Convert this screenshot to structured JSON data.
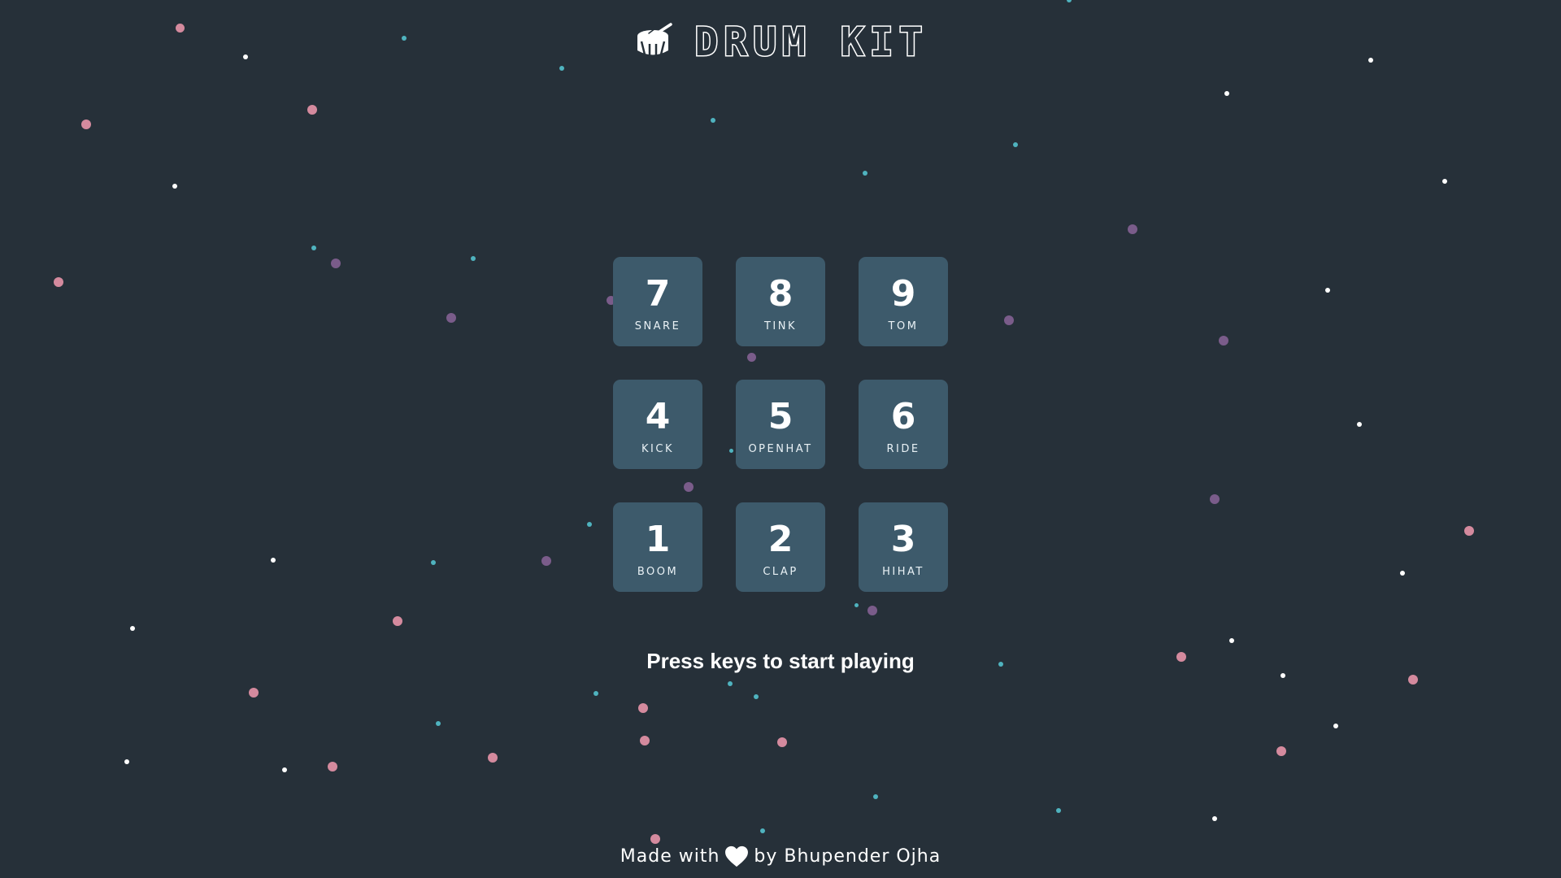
{
  "app": {
    "title": "DRUM KIT",
    "icon": "drum-icon"
  },
  "pads": [
    {
      "key": "7",
      "sound": "SNARE"
    },
    {
      "key": "8",
      "sound": "TINK"
    },
    {
      "key": "9",
      "sound": "TOM"
    },
    {
      "key": "4",
      "sound": "KICK"
    },
    {
      "key": "5",
      "sound": "OPENHAT"
    },
    {
      "key": "6",
      "sound": "RIDE"
    },
    {
      "key": "1",
      "sound": "BOOM"
    },
    {
      "key": "2",
      "sound": "CLAP"
    },
    {
      "key": "3",
      "sound": "HIHAT"
    }
  ],
  "hint": "Press keys to start playing",
  "footer": {
    "made_with": "Made with",
    "heart_icon": "heart-icon",
    "by": "by Bhupender Ojha"
  },
  "colors": {
    "background": "#263039",
    "pad": "#3d5a6b",
    "dot_pink": "#d48a9e",
    "dot_teal": "#4fb3bf",
    "dot_white": "#ffffff",
    "dot_purple": "#7a5c8a"
  }
}
